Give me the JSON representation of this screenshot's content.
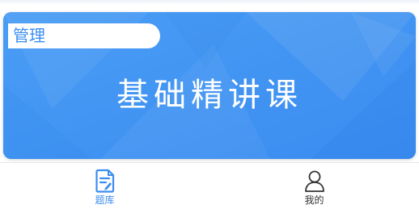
{
  "course_card": {
    "tag": "管理",
    "title": "基础精讲课"
  },
  "tabbar": {
    "items": [
      {
        "label": "题库",
        "icon": "question-bank-icon",
        "active": true
      },
      {
        "label": "我的",
        "icon": "user-profile-icon",
        "active": false
      }
    ]
  },
  "colors": {
    "accent": "#3b8ef0",
    "card_bg": "#3f93f2",
    "inactive_text": "#333333"
  }
}
